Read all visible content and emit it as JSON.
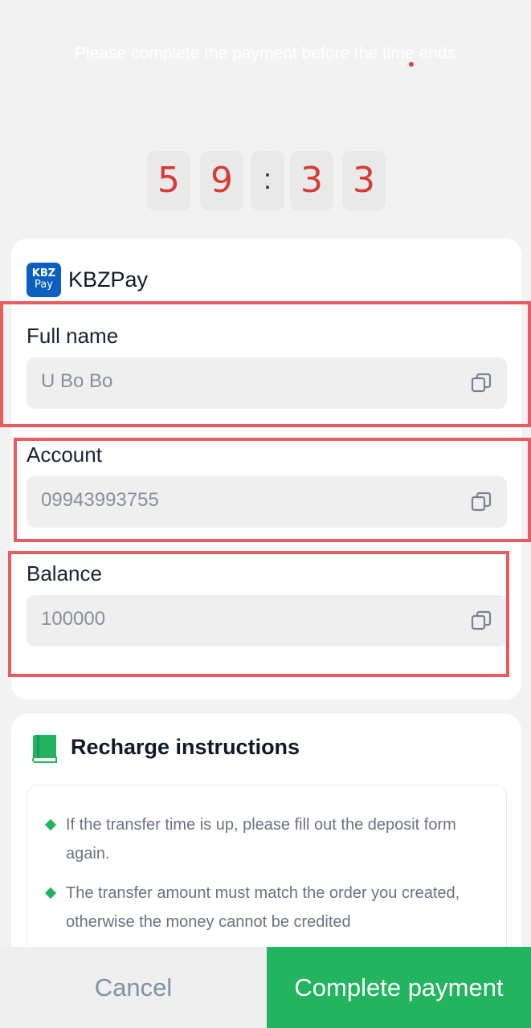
{
  "notice": "Please complete the payment before the time ends",
  "timer": {
    "digits": [
      "5",
      "9",
      ":",
      "3",
      "3"
    ]
  },
  "payment": {
    "brand_logo_line1": "KBZ",
    "brand_logo_line2": "Pay",
    "brand_name": "KBZPay",
    "fields": [
      {
        "label": "Full name",
        "value": "U Bo Bo"
      },
      {
        "label": "Account",
        "value": "09943993755"
      },
      {
        "label": "Balance",
        "value": "100000"
      }
    ]
  },
  "instructions": {
    "title": "Recharge instructions",
    "items": [
      "If the transfer time is up, please fill out the deposit form again.",
      "The transfer amount must match the order you created, otherwise the money cannot be credited"
    ]
  },
  "buttons": {
    "cancel": "Cancel",
    "complete": "Complete payment"
  },
  "colors": {
    "accent_green": "#22b45f",
    "timer_red": "#d63b34",
    "highlight_red": "#ea5a5f",
    "brand_blue": "#0b5fc1"
  },
  "icons": {
    "copy": "copy-icon",
    "book": "book-icon"
  }
}
